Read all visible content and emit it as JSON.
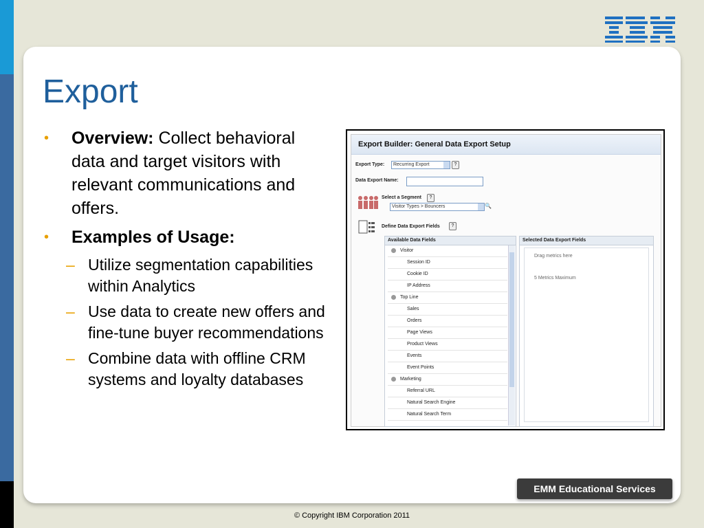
{
  "brand": {
    "logo_text": "IBM",
    "badge": "EMM Educational Services"
  },
  "slide": {
    "title": "Export",
    "overview_label": "Overview:",
    "overview_text": " Collect behavioral data and target visitors with relevant communications and offers.",
    "examples_label": "Examples of Usage:",
    "examples": [
      "Utilize segmentation capabilities within Analytics",
      "Use data to create new offers and fine-tune buyer recommendations",
      "Combine data with offline CRM systems and loyalty databases"
    ]
  },
  "export_builder": {
    "title": "Export Builder: General Data Export Setup",
    "export_type_label": "Export Type:",
    "export_type_value": "Recurring Export",
    "export_name_label": "Data Export Name:",
    "segment_label": "Select a Segment",
    "segment_value": "Visitor Types > Bouncers",
    "define_label": "Define Data Export Fields",
    "available_header": "Available Data Fields",
    "selected_header": "Selected Data Export Fields",
    "drag_hint": "Drag metrics here",
    "max_hint": "5 Metrics Maximum",
    "groups": [
      {
        "name": "Visitor",
        "items": [
          "Session ID",
          "Cookie ID",
          "IP Address"
        ]
      },
      {
        "name": "Top Line",
        "items": [
          "Sales",
          "Orders",
          "Page Views",
          "Product Views",
          "Events",
          "Event Points"
        ]
      },
      {
        "name": "Marketing",
        "items": [
          "Referral URL",
          "Natural Search Engine",
          "Natural Search Term"
        ]
      }
    ]
  },
  "footer": {
    "copyright": "© Copyright IBM Corporation 2011"
  },
  "colors": {
    "title": "#1f5f9c",
    "bullet": "#e8a000",
    "sidebar": "#3a6aa0",
    "sidebar_top": "#1a9ad6"
  }
}
